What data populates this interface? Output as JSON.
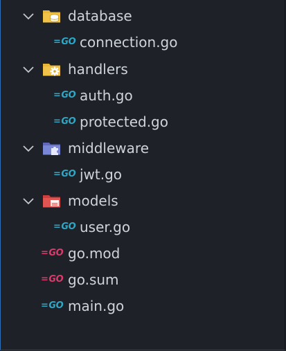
{
  "tree": {
    "folders": [
      {
        "label": "database",
        "icon": "database-folder-icon",
        "color": "#e8b73a",
        "children": [
          {
            "label": "connection.go",
            "icon": "go-file-icon"
          }
        ]
      },
      {
        "label": "handlers",
        "icon": "gear-folder-icon",
        "color": "#e8b73a",
        "children": [
          {
            "label": "auth.go",
            "icon": "go-file-icon"
          },
          {
            "label": "protected.go",
            "icon": "go-file-icon"
          }
        ]
      },
      {
        "label": "middleware",
        "icon": "puzzle-folder-icon",
        "color": "#7a86d6",
        "children": [
          {
            "label": "jwt.go",
            "icon": "go-file-icon"
          }
        ]
      },
      {
        "label": "models",
        "icon": "models-folder-icon",
        "color": "#e05552",
        "children": [
          {
            "label": "user.go",
            "icon": "go-file-icon"
          }
        ]
      }
    ],
    "root_files": [
      {
        "label": "go.mod",
        "icon": "go-mod-icon",
        "color": "#e0386b"
      },
      {
        "label": "go.sum",
        "icon": "go-sum-icon",
        "color": "#e0386b"
      },
      {
        "label": "main.go",
        "icon": "go-file-icon",
        "color": "#2aa9c9"
      }
    ],
    "go_badge": "GO",
    "go_dash": "="
  }
}
